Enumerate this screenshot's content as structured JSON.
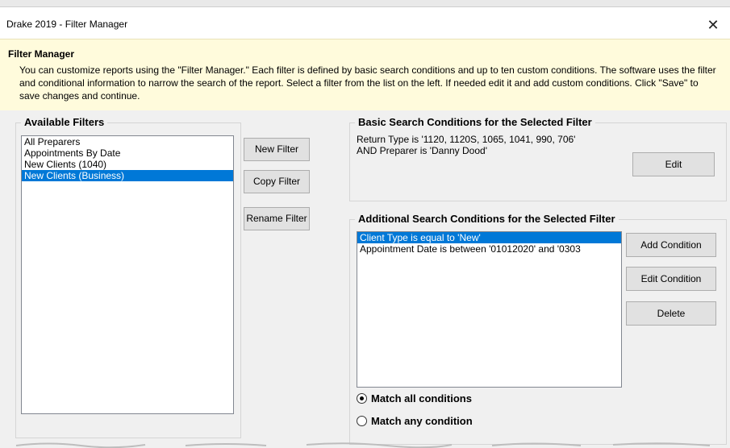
{
  "window": {
    "title": "Drake 2019 - Filter Manager",
    "close_symbol": "✕"
  },
  "info": {
    "heading": "Filter Manager",
    "body": "You can customize reports using the \"Filter Manager.\"  Each filter is defined by basic search conditions and up to ten custom conditions.  The software uses the filter and conditional information to narrow the search of the report.  Select a filter from the list on the left.  If needed edit it and add custom conditions.  Click \"Save\" to save changes and continue."
  },
  "available_filters": {
    "heading": "Available Filters",
    "items": [
      "All Preparers",
      "Appointments By Date",
      "New Clients (1040)",
      "New Clients (Business)"
    ],
    "selected_index": 3
  },
  "filter_buttons": {
    "new": "New Filter",
    "copy": "Copy Filter",
    "rename": "Rename Filter"
  },
  "basic_conditions": {
    "heading": "Basic Search Conditions for the Selected Filter",
    "line1": "Return Type is '1120, 1120S, 1065, 1041, 990, 706'",
    "line2": "AND Preparer is 'Danny Dood'",
    "edit_label": "Edit"
  },
  "additional_conditions": {
    "heading": "Additional Search Conditions for the Selected Filter",
    "items": [
      "Client Type is equal to 'New'",
      "Appointment Date is between '01012020' and '0303"
    ],
    "selected_index": 0,
    "add_label": "Add Condition",
    "edit_label": "Edit Condition",
    "delete_label": "Delete"
  },
  "match": {
    "all_label": "Match all conditions",
    "any_label": "Match any condition",
    "selected": "all"
  }
}
